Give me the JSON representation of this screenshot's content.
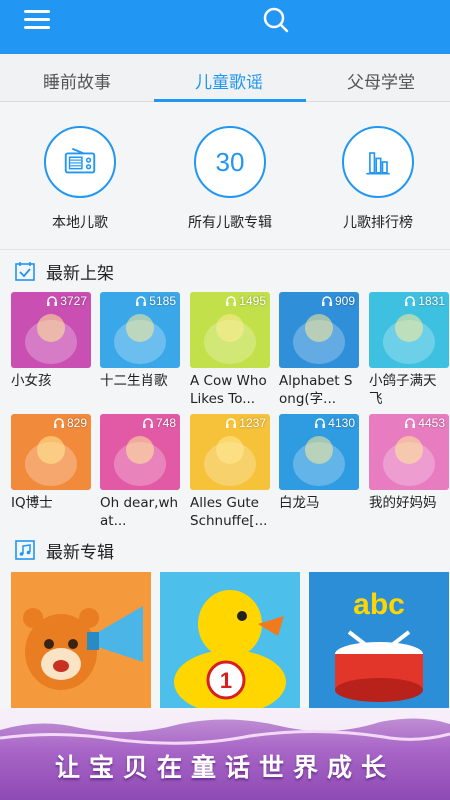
{
  "header": {
    "menu_icon": "hamburger-menu-icon",
    "search_icon": "search-icon",
    "accent": "#2196f3"
  },
  "tabs": [
    {
      "label": "睡前故事",
      "active": false
    },
    {
      "label": "儿童歌谣",
      "active": true
    },
    {
      "label": "父母学堂",
      "active": false
    }
  ],
  "categories": [
    {
      "label": "本地儿歌",
      "icon": "radio-icon"
    },
    {
      "label": "所有儿歌专辑",
      "icon_text": "30"
    },
    {
      "label": "儿歌排行榜",
      "icon": "bar-chart-icon"
    }
  ],
  "latest": {
    "title": "最新上架",
    "icon": "calendar-check-icon",
    "items": [
      {
        "title": "小女孩",
        "plays": "3727",
        "bg": "#c94fb3"
      },
      {
        "title": "十二生肖歌",
        "plays": "5185",
        "bg": "#3aa8e8"
      },
      {
        "title": "A Cow Who Likes To...",
        "plays": "1495",
        "bg": "#c2e04a"
      },
      {
        "title": "Alphabet Song(字...",
        "plays": "909",
        "bg": "#2f8fd8"
      },
      {
        "title": "小鸽子满天飞",
        "plays": "1831",
        "bg": "#3ec0e0"
      },
      {
        "title": "IQ博士",
        "plays": "829",
        "bg": "#f28a3c"
      },
      {
        "title": "Oh dear,what...",
        "plays": "748",
        "bg": "#e25aa6"
      },
      {
        "title": "Alles Gute Schnuffe[...",
        "plays": "1237",
        "bg": "#f5c23a"
      },
      {
        "title": "白龙马",
        "plays": "4130",
        "bg": "#2f9be0"
      },
      {
        "title": "我的好妈妈",
        "plays": "4453",
        "bg": "#e87cc0"
      }
    ]
  },
  "albums": {
    "title": "最新专辑",
    "icon": "music-note-icon",
    "items": [
      {
        "name": "beaver-megaphone-album",
        "bg": "#f59a3c"
      },
      {
        "name": "yellow-duck-album",
        "bg": "#4cc0ea"
      },
      {
        "name": "abc-drum-album",
        "bg": "#2d8ed8"
      }
    ]
  },
  "banner": {
    "text": "让宝贝在童话世界成长"
  }
}
